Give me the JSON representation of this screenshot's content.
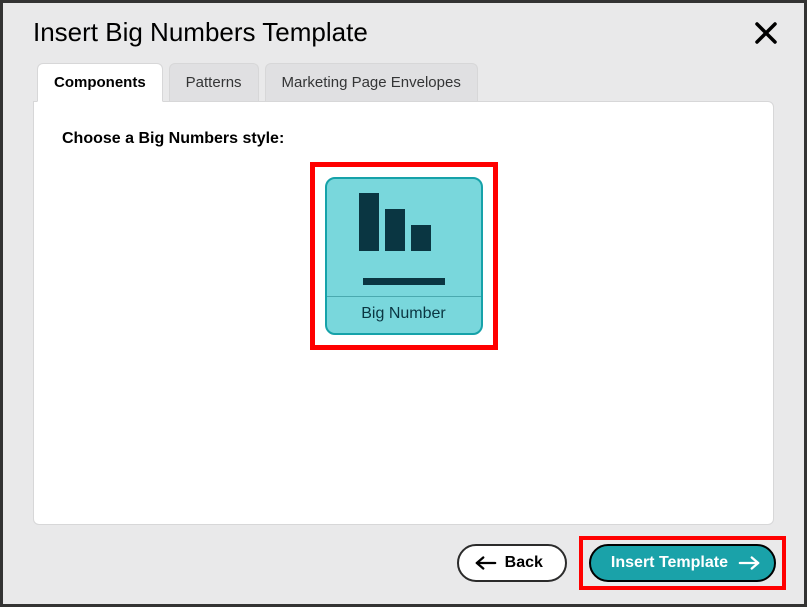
{
  "dialog": {
    "title": "Insert Big Numbers Template"
  },
  "tabs": {
    "components": "Components",
    "patterns": "Patterns",
    "marketing": "Marketing Page Envelopes"
  },
  "panel": {
    "prompt": "Choose a Big Numbers style:",
    "tile_label": "Big Number"
  },
  "footer": {
    "back": "Back",
    "insert": "Insert Template"
  }
}
